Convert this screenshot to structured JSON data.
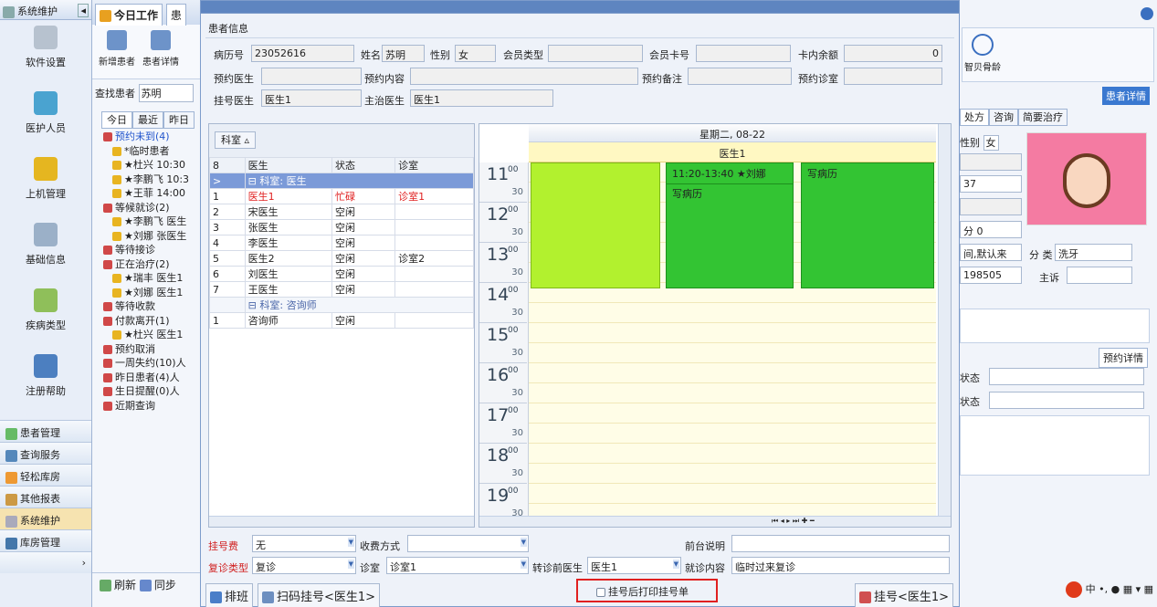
{
  "sidebar": {
    "header": "系统维护",
    "buttons": [
      "软件设置",
      "医护人员",
      "上机管理",
      "基础信息",
      "疾病类型",
      "注册帮助"
    ],
    "nav": [
      "患者管理",
      "查询服务",
      "轻松库房",
      "其他报表",
      "系统维护",
      "库房管理"
    ]
  },
  "middle": {
    "tab": "今日工作",
    "tab2": "患",
    "toolbar": [
      "新增患者",
      "患者详情"
    ],
    "search_label": "查找患者",
    "search_value": "苏明",
    "subtabs": [
      "今日",
      "最近",
      "昨日"
    ],
    "tree": [
      {
        "t": "预约未到(4)",
        "c": "#2255cc",
        "lv": 1
      },
      {
        "t": "*临时患者",
        "lv": 2
      },
      {
        "t": "★杜兴 10:30",
        "lv": 2
      },
      {
        "t": "★李鹏飞 10:3",
        "lv": 2
      },
      {
        "t": "★王菲 14:00",
        "lv": 2
      },
      {
        "t": "等候就诊(2)",
        "lv": 1
      },
      {
        "t": "★李鹏飞 医生",
        "lv": 2
      },
      {
        "t": "★刘娜 张医生",
        "lv": 2
      },
      {
        "t": "等待接诊",
        "lv": 1
      },
      {
        "t": "正在治疗(2)",
        "lv": 1
      },
      {
        "t": "★瑞丰 医生1",
        "lv": 2
      },
      {
        "t": "★刘娜 医生1",
        "lv": 2
      },
      {
        "t": "等待收款",
        "lv": 1
      },
      {
        "t": "付款离开(1)",
        "lv": 1
      },
      {
        "t": "★杜兴 医生1",
        "lv": 2
      },
      {
        "t": "预约取消",
        "lv": 1
      },
      {
        "t": "一周失约(10)人",
        "lv": 1
      },
      {
        "t": "昨日患者(4)人",
        "lv": 1
      },
      {
        "t": "生日提醒(0)人",
        "lv": 1
      },
      {
        "t": "近期查询",
        "lv": 1
      }
    ],
    "bottom": [
      "刷新",
      "同步"
    ]
  },
  "dialog": {
    "section": "患者信息",
    "f": {
      "record_label": "病历号",
      "record": "23052616",
      "name_label": "姓名",
      "name": "苏明",
      "sex_label": "性别",
      "sex": "女",
      "member_label": "会员类型",
      "member": "",
      "card_label": "会员卡号",
      "card": "",
      "balance_label": "卡内余额",
      "balance": "0",
      "appt_doc_label": "预约医生",
      "appt_content_label": "预约内容",
      "appt_note_label": "预约备注",
      "appt_room_label": "预约诊室",
      "reg_doc_label": "挂号医生",
      "reg_doc": "医生1",
      "main_doc_label": "主治医生",
      "main_doc": "医生1"
    },
    "group_label": "科室",
    "grid_head": [
      "8",
      "医生",
      "状态",
      "诊室"
    ],
    "grid": [
      {
        "g": "科室: 医生"
      },
      {
        "n": "1",
        "d": "医生1",
        "s": "忙碌",
        "r": "诊室1",
        "red": true
      },
      {
        "n": "2",
        "d": "宋医生",
        "s": "空闲",
        "r": ""
      },
      {
        "n": "3",
        "d": "张医生",
        "s": "空闲",
        "r": ""
      },
      {
        "n": "4",
        "d": "李医生",
        "s": "空闲",
        "r": ""
      },
      {
        "n": "5",
        "d": "医生2",
        "s": "空闲",
        "r": "诊室2"
      },
      {
        "n": "6",
        "d": "刘医生",
        "s": "空闲",
        "r": ""
      },
      {
        "n": "7",
        "d": "王医生",
        "s": "空闲",
        "r": ""
      },
      {
        "g": "科室: 咨询师"
      },
      {
        "n": "1",
        "d": "咨询师",
        "s": "空闲",
        "r": ""
      }
    ],
    "cal": {
      "date": "星期二, 08-22",
      "resource": "医生1",
      "hours": [
        "11",
        "12",
        "13",
        "14",
        "15",
        "16",
        "17",
        "18",
        "19"
      ],
      "half": "30",
      "zero": "00",
      "appt_time": "11:20-13:40 ★刘娜",
      "appt_note": "写病历",
      "appt3": "写病历"
    },
    "bottom": {
      "fee_label": "挂号费",
      "fee": "无",
      "pay_label": "收费方式",
      "front_label": "前台说明",
      "revisit_label": "复诊类型",
      "revisit": "复诊",
      "room_label": "诊室",
      "room": "诊室1",
      "prev_doc_label": "转诊前医生",
      "prev_doc": "医生1",
      "visit_label": "就诊内容",
      "visit": "临时过来复诊"
    },
    "actions": {
      "schedule": "排班",
      "scan": "扫码挂号<医生1>",
      "print": "挂号后打印挂号单",
      "register": "挂号<医生1>"
    }
  },
  "right": {
    "btn": "智贝骨龄",
    "detail": "患者详情",
    "tabs": [
      "处方",
      "咨询",
      "简要治疗"
    ],
    "sex_label": "性别",
    "sex": "女",
    "v1": "37",
    "v2": "分 0",
    "v3": "间,默认来",
    "cat_label": "分 类",
    "cat": "洗牙",
    "v4": "198505",
    "chief": "主诉",
    "appt_detail": "预约详情",
    "st1": "状态",
    "st2": "状态"
  }
}
